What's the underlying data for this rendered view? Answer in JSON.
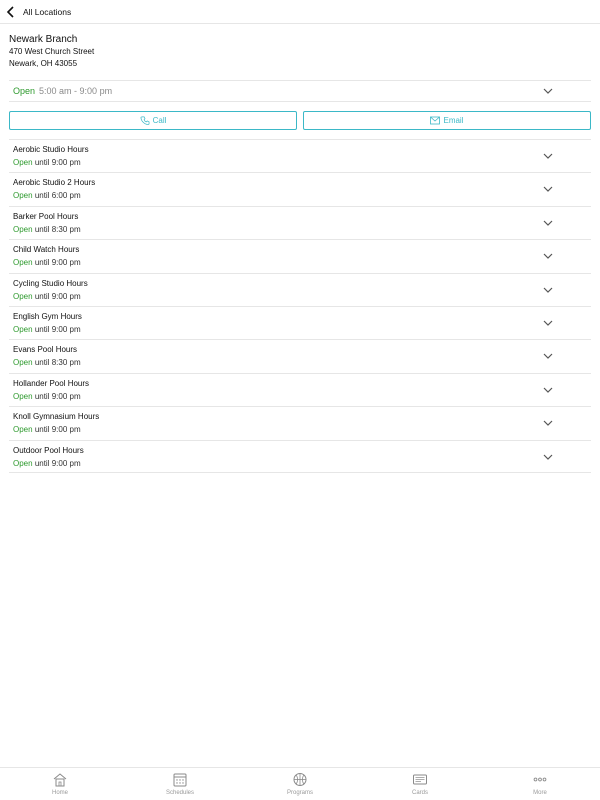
{
  "nav": {
    "back_label": "All Locations"
  },
  "branch": {
    "name": "Newark Branch",
    "address_line1": "470 West Church Street",
    "address_line2": "Newark, OH 43055"
  },
  "hours": {
    "status": "Open",
    "range": "5:00 am - 9:00 pm"
  },
  "actions": {
    "call_label": "Call",
    "email_label": "Email"
  },
  "colors": {
    "open_green": "#2e9a2e",
    "accent_teal": "#3bb8c7"
  },
  "facilities": [
    {
      "name": "Aerobic Studio Hours",
      "status": "Open",
      "until": "until 9:00 pm"
    },
    {
      "name": "Aerobic Studio 2 Hours",
      "status": "Open",
      "until": "until 6:00 pm"
    },
    {
      "name": "Barker Pool Hours",
      "status": "Open",
      "until": "until 8:30 pm"
    },
    {
      "name": "Child Watch Hours",
      "status": "Open",
      "until": "until 9:00 pm"
    },
    {
      "name": "Cycling Studio Hours",
      "status": "Open",
      "until": "until 9:00 pm"
    },
    {
      "name": "English Gym Hours",
      "status": "Open",
      "until": "until 9:00 pm"
    },
    {
      "name": "Evans Pool Hours",
      "status": "Open",
      "until": "until 8:30 pm"
    },
    {
      "name": "Hollander Pool Hours",
      "status": "Open",
      "until": "until 9:00 pm"
    },
    {
      "name": "Knoll Gymnasium Hours",
      "status": "Open",
      "until": "until 9:00 pm"
    },
    {
      "name": "Outdoor Pool Hours",
      "status": "Open",
      "until": "until 9:00 pm"
    }
  ],
  "tabs": [
    {
      "label": "Home",
      "icon": "home-icon"
    },
    {
      "label": "Schedules",
      "icon": "calendar-icon"
    },
    {
      "label": "Programs",
      "icon": "basketball-icon"
    },
    {
      "label": "Cards",
      "icon": "card-icon"
    },
    {
      "label": "More",
      "icon": "more-icon"
    }
  ]
}
